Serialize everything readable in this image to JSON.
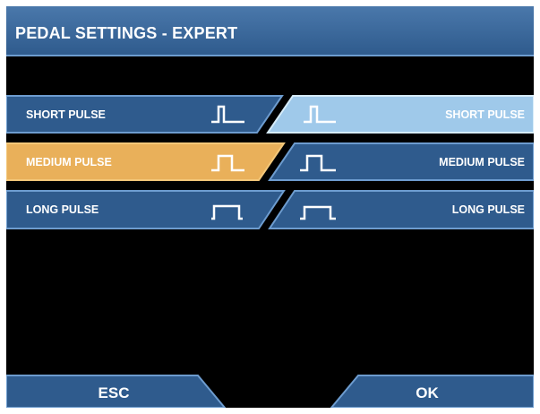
{
  "header": {
    "title": "PEDAL SETTINGS - EXPERT"
  },
  "left_options": [
    {
      "label": "SHORT PULSE",
      "pulse": "short",
      "selected": false
    },
    {
      "label": "MEDIUM PULSE",
      "pulse": "medium",
      "selected": true
    },
    {
      "label": "LONG PULSE",
      "pulse": "long",
      "selected": false
    }
  ],
  "right_options": [
    {
      "label": "SHORT PULSE",
      "pulse": "short",
      "selected": true
    },
    {
      "label": "MEDIUM PULSE",
      "pulse": "medium",
      "selected": false
    },
    {
      "label": "LONG PULSE",
      "pulse": "long",
      "selected": false
    }
  ],
  "footer": {
    "esc_label": "ESC",
    "ok_label": "OK"
  },
  "colors": {
    "panel_blue": "#2f5b8d",
    "panel_border": "#6d9ccf",
    "selected_orange": "#e9b05a",
    "selected_orange_border": "#f3c779",
    "selected_light_blue": "#9fc9ea",
    "screen_black": "#000000"
  }
}
